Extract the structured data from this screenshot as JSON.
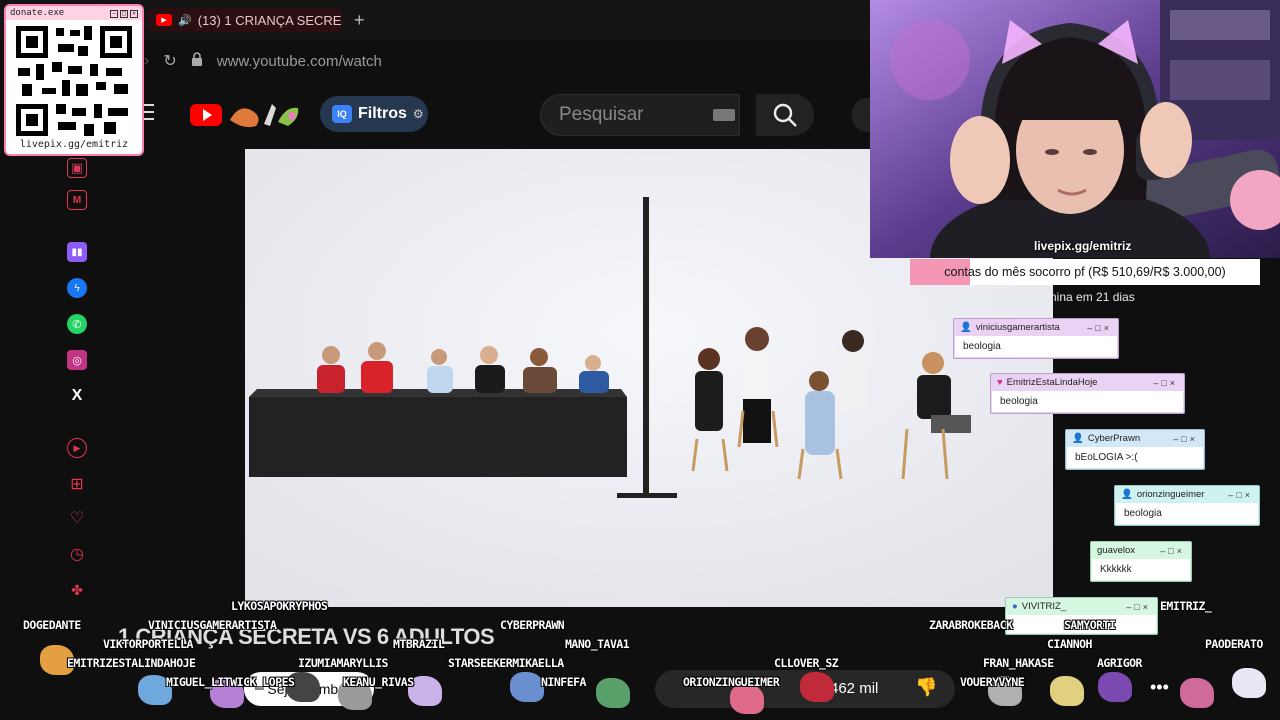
{
  "browser": {
    "tab_title": "(13) 1 CRIANÇA SECRE",
    "new_tab_symbol": "+",
    "url": "www.youtube.com/watch"
  },
  "youtube": {
    "filters_label": "Filtros",
    "filters_badge": "IQ",
    "search_placeholder": "Pesquisar",
    "video_title": "1 CRIANÇA SECRETA VS 6 ADULTOS",
    "subscribe_label": "Seja membro",
    "likes": "462 mil"
  },
  "donate_widget": {
    "title": "donate.exe",
    "caption": "livepix.gg/emitriz"
  },
  "webcam": {
    "label": "livepix.gg/emitriz"
  },
  "goal": {
    "text": "contas do mês socorro pf (R$ 510,69/R$ 3.000,00)",
    "progress_fraction": 0.17,
    "subtitle": "Termina em 21 dias",
    "fill_color": "#f497b4"
  },
  "chat_popups": [
    {
      "user": "viniciusgamerartista",
      "message": "beologia",
      "color": "#ead2f5"
    },
    {
      "user": "EmitrizEstaLindaHoje",
      "message": "beologia",
      "color": "#ead2f5"
    },
    {
      "user": "CyberPrawn",
      "message": "bEoLOGIA >:(",
      "color": "#d2e8f7"
    },
    {
      "user": "orionzingueimer",
      "message": "beologia",
      "color": "#cdf2ef"
    },
    {
      "user": "guavelox",
      "message": "Kkkkkk",
      "color": "#d5f6e0"
    },
    {
      "user": "VIVITRIZ_",
      "message": "",
      "color": "#d5f6e0"
    }
  ],
  "usernames": [
    "LYKOSAPOKRYPHOS",
    "DOGEDANTE",
    "VINICIUSGAMERARTISTA",
    "CYBERPRAWN",
    "ZARABROKEBACK",
    "SAMYORTI",
    "EMITRIZ_",
    "VIKTORPORTELLA",
    "MTBRAZIL",
    "MANO_TAVA1",
    "CIANNOH",
    "PAODERATO",
    "EMITRIZESTALINDAHOJE",
    "IZUMIAMARYLLIS",
    "STARSEEKERMIKAELLA",
    "CLLOVER_SZ",
    "FRAN_HAKASE",
    "AGRIGOR",
    "MIGUEL_LITWICK_LOPES",
    "KEANU_RIVAS",
    "NINFEFA",
    "ORIONZINGUEIMER",
    "VOUERYVYNE"
  ]
}
